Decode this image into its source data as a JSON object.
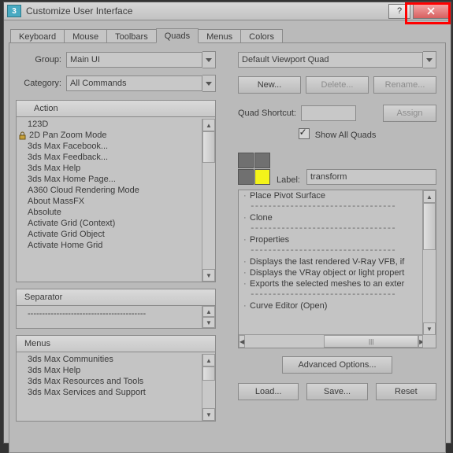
{
  "titlebar": {
    "icon_text": "3",
    "title": "Customize User Interface"
  },
  "tabs": [
    "Keyboard",
    "Mouse",
    "Toolbars",
    "Quads",
    "Menus",
    "Colors"
  ],
  "active_tab": 3,
  "left": {
    "group_label": "Group:",
    "group_value": "Main UI",
    "category_label": "Category:",
    "category_value": "All Commands",
    "action_header": "Action",
    "action_items": [
      {
        "label": "123D"
      },
      {
        "label": "2D Pan Zoom Mode",
        "icon": "lock"
      },
      {
        "label": "3ds Max Facebook..."
      },
      {
        "label": "3ds Max Feedback..."
      },
      {
        "label": "3ds Max Help"
      },
      {
        "label": "3ds Max Home Page..."
      },
      {
        "label": "A360 Cloud Rendering Mode"
      },
      {
        "label": "About MassFX"
      },
      {
        "label": "Absolute"
      },
      {
        "label": "Activate Grid (Context)"
      },
      {
        "label": "Activate Grid Object"
      },
      {
        "label": "Activate Home Grid"
      }
    ],
    "separator_header": "Separator",
    "separator_row": "-----------------------------------------",
    "menus_header": "Menus",
    "menus_items": [
      "3ds Max Communities",
      "3ds Max Help",
      "3ds Max Resources and Tools",
      "3ds Max Services and Support"
    ]
  },
  "right": {
    "quad_dropdown": "Default Viewport Quad",
    "new_btn": "New...",
    "delete_btn": "Delete...",
    "rename_btn": "Rename...",
    "shortcut_label": "Quad Shortcut:",
    "shortcut_value": "",
    "assign_btn": "Assign",
    "show_all_label": "Show All Quads",
    "show_all_checked": true,
    "label_label": "Label:",
    "label_value": "transform",
    "tree_items": [
      {
        "type": "item",
        "text": "Place Pivot Surface"
      },
      {
        "type": "dash"
      },
      {
        "type": "item",
        "text": "Clone"
      },
      {
        "type": "dash"
      },
      {
        "type": "item",
        "text": "Properties"
      },
      {
        "type": "dash"
      },
      {
        "type": "item",
        "text": "Displays the last rendered V-Ray VFB, if"
      },
      {
        "type": "item",
        "text": "Displays the VRay object or light propert"
      },
      {
        "type": "item",
        "text": "Exports the selected meshes to an exter"
      },
      {
        "type": "dash"
      },
      {
        "type": "item",
        "text": "Curve Editor (Open)"
      }
    ],
    "advanced_btn": "Advanced Options...",
    "load_btn": "Load...",
    "save_btn": "Save...",
    "reset_btn": "Reset"
  }
}
